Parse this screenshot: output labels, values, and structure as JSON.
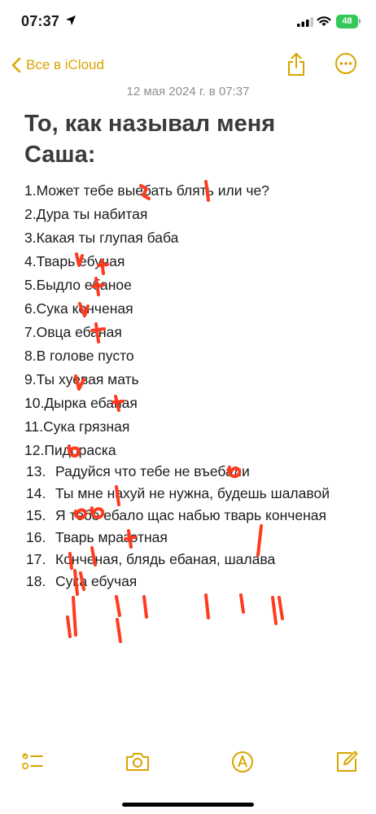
{
  "status": {
    "time": "07:37",
    "battery": "48"
  },
  "nav": {
    "back_label": "Все в iCloud"
  },
  "note": {
    "date": "12 мая 2024 г. в 07:37",
    "title": "То, как называл меня Саша:",
    "lines": [
      "1.Может тебе выебать блять или че?",
      "2.Дура ты набитая",
      "3.Какая ты глупая баба",
      "4.Тварь ебучая",
      "5.Быдло ебаное",
      "6.Сука конченая",
      "7.Овца ебаная",
      "8.В голове пусто",
      "9.Ты хуевая мать",
      "10.Дырка ебаная",
      "11.Сука грязная",
      "12.Пидораска"
    ],
    "ordered": [
      {
        "num": "13.",
        "text": "Радуйся что тебе не въебали"
      },
      {
        "num": "14.",
        "text": "Ты мне нахуй не нужна, будешь шалавой"
      },
      {
        "num": "15.",
        "text": "Я тебе ебало щас набью тварь конченая"
      },
      {
        "num": "16.",
        "text": "Тварь мразотная"
      },
      {
        "num": "17.",
        "text": "Конченая, блядь ебаная, шалава"
      },
      {
        "num": "18.",
        "text": "Сука ебучая"
      }
    ]
  },
  "icons": {
    "location": "location-arrow-icon",
    "back": "chevron-left-icon",
    "share": "share-icon",
    "more": "ellipsis-circle-icon",
    "checklist": "checklist-icon",
    "camera": "camera-icon",
    "markup": "markup-pen-icon",
    "compose": "compose-icon"
  },
  "colors": {
    "accent": "#d9a400",
    "scribble": "#ff3b1f",
    "battery": "#34c759"
  }
}
